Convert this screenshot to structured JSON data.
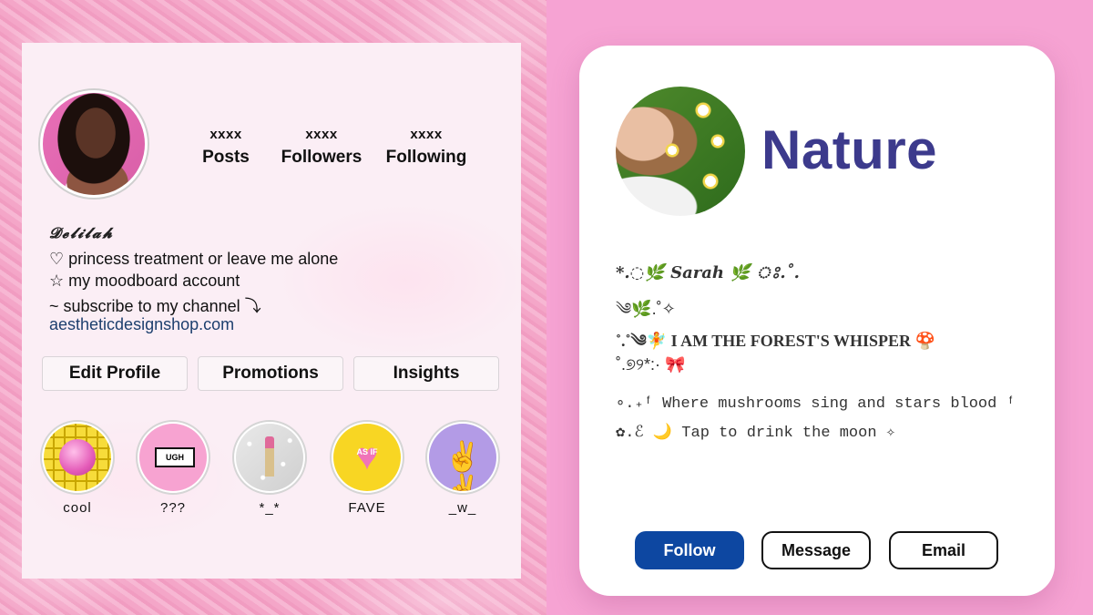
{
  "left_profile": {
    "stats": [
      {
        "value": "xxxx",
        "label": "Posts"
      },
      {
        "value": "xxxx",
        "label": "Followers"
      },
      {
        "value": "xxxx",
        "label": "Following"
      }
    ],
    "name": "𝓓𝓮𝓵𝓲𝓵𝓪𝓱",
    "bio": [
      "♡ princess treatment or leave me alone",
      "☆ my moodboard account",
      "~ subscribe to my channel ⤵"
    ],
    "link": "aestheticdesignshop.com",
    "buttons": [
      "Edit Profile",
      "Promotions",
      "Insights"
    ],
    "highlights": [
      {
        "label": "cool",
        "cover": "bubblegum-on-yellow-plaid"
      },
      {
        "label": "???",
        "cover": "ugh-speech-bubble",
        "cover_text": "UGH"
      },
      {
        "label": "*_*",
        "cover": "lipstick-on-glitter"
      },
      {
        "label": "FAVE",
        "cover": "candy-heart",
        "cover_text": "AS IF"
      },
      {
        "label": "_w_",
        "cover": "peace-hands"
      }
    ]
  },
  "right_profile": {
    "title": "Nature",
    "bio": [
      "*.◌🌿 Sarah 🌿 ঃ.˚.",
      "༄🌿.˚✧",
      "˚.˚༄🧚 I AM THE FOREST'S WHISPER 🍄",
      "˚.୭୨*:· 🎀",
      "∘.₊ᶠ Where mushrooms sing and stars blood ᶠ",
      "✿.ℰ 🌙 Tap to drink the moon ✧"
    ],
    "buttons": [
      "Follow",
      "Message",
      "Email"
    ]
  },
  "colors": {
    "nature_title": "#3c3a8c",
    "follow_button": "#0d47a1",
    "background_pink": "#f6a3d3"
  }
}
